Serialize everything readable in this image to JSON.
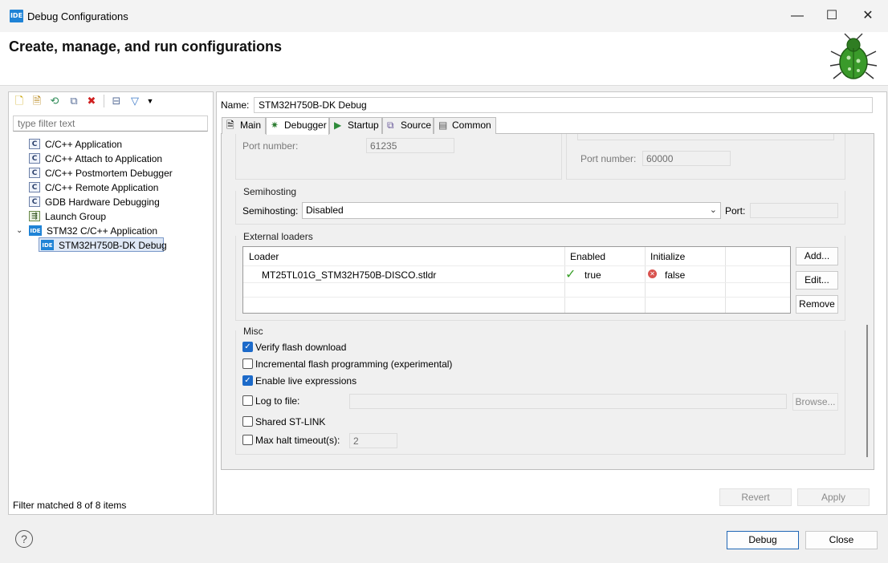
{
  "window": {
    "title": "Debug Configurations",
    "app_icon": "IDE",
    "minimize": "—",
    "maximize": "☐",
    "close": "✕"
  },
  "header": {
    "title": "Create, manage, and run configurations"
  },
  "left": {
    "filter_placeholder": "type filter text",
    "tree": [
      {
        "icon": "c-icon",
        "badge": "C",
        "label": "C/C++ Application"
      },
      {
        "icon": "c-icon",
        "badge": "C",
        "label": "C/C++ Attach to Application"
      },
      {
        "icon": "c-icon",
        "badge": "C",
        "label": "C/C++ Postmortem Debugger"
      },
      {
        "icon": "c-icon",
        "badge": "C",
        "label": "C/C++ Remote Application"
      },
      {
        "icon": "c-icon",
        "badge": "C",
        "label": "GDB Hardware Debugging"
      },
      {
        "icon": "launch-group-icon",
        "badge": "⇶",
        "label": "Launch Group"
      },
      {
        "icon": "ide-icon",
        "badge": "IDE",
        "label": "STM32 C/C++ Application"
      },
      {
        "icon": "ide-icon",
        "badge": "IDE",
        "label": "STM32H750B-DK Debug"
      }
    ],
    "status": "Filter matched 8 of 8 items"
  },
  "right": {
    "name_label": "Name:",
    "name_value": "STM32H750B-DK Debug",
    "tabs": [
      "Main",
      "Debugger",
      "Startup",
      "Source",
      "Common"
    ],
    "port_label_left": "Port number:",
    "port_value_left": "61235",
    "port_label_right": "Port number:",
    "port_value_right": "60000",
    "semihosting": {
      "group_title": "Semihosting",
      "label": "Semihosting:",
      "value": "Disabled",
      "port_label": "Port:",
      "port_value": ""
    },
    "loaders": {
      "group_title": "External loaders",
      "columns": [
        "Loader",
        "Enabled",
        "Initialize"
      ],
      "rows": [
        {
          "loader": "MT25TL01G_STM32H750B-DISCO.stldr",
          "enabled": "true",
          "initialize": "false"
        }
      ],
      "add": "Add...",
      "edit": "Edit...",
      "remove": "Remove"
    },
    "misc": {
      "group_title": "Misc",
      "verify": {
        "label": "Verify flash download",
        "checked": true
      },
      "incremental": {
        "label": "Incremental flash programming (experimental)",
        "checked": false
      },
      "live": {
        "label": "Enable live expressions",
        "checked": true
      },
      "log": {
        "label": "Log to file:",
        "checked": false,
        "value": ""
      },
      "browse": "Browse...",
      "shared": {
        "label": "Shared ST-LINK",
        "checked": false
      },
      "halt": {
        "label": "Max halt timeout(s):",
        "checked": false,
        "value": "2"
      }
    },
    "revert": "Revert",
    "apply": "Apply"
  },
  "footer": {
    "help": "?",
    "debug": "Debug",
    "close": "Close"
  },
  "colors": {
    "accent": "#1c6ac9",
    "ide_badge": "#1f83d6",
    "tab_active": "#ffffff"
  }
}
